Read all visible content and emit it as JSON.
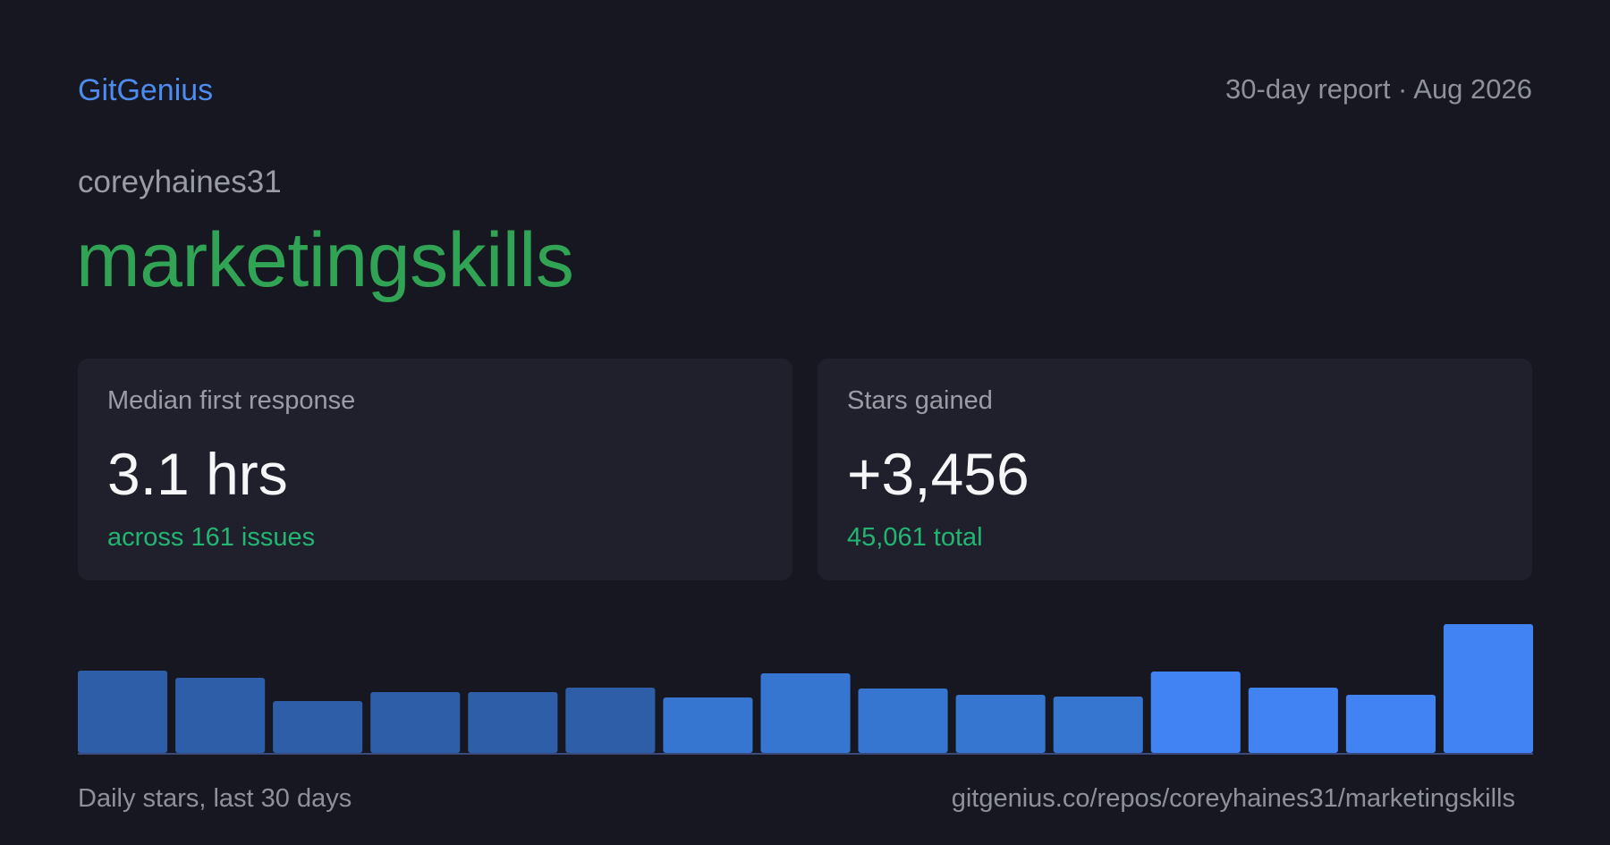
{
  "header": {
    "brand": "GitGenius",
    "report": "30-day report · Aug 2026"
  },
  "repo": {
    "owner": "coreyhaines31",
    "name": "marketingskills"
  },
  "cards": [
    {
      "label": "Median first response",
      "value": "3.1 hrs",
      "sub": "across 161 issues"
    },
    {
      "label": "Stars gained",
      "value": "+3,456",
      "sub": "45,061 total"
    }
  ],
  "footer": {
    "caption": "Daily stars, last 30 days",
    "url": "gitgenius.co/repos/coreyhaines31/marketingskills"
  },
  "chart_data": {
    "type": "bar",
    "values": [
      92,
      84,
      58,
      68,
      68,
      73,
      62,
      89,
      72,
      65,
      63,
      91,
      73,
      65,
      144
    ],
    "colors": [
      "#2f5ea8",
      "#2f5ea8",
      "#2f5ea8",
      "#2f5ea8",
      "#2f5ea8",
      "#2f5ea8",
      "#3675d0",
      "#3675d0",
      "#3675d0",
      "#3675d0",
      "#3675d0",
      "#4283f3",
      "#4283f3",
      "#4283f3",
      "#4283f3"
    ],
    "baseline_color": "#3a4a7a"
  }
}
